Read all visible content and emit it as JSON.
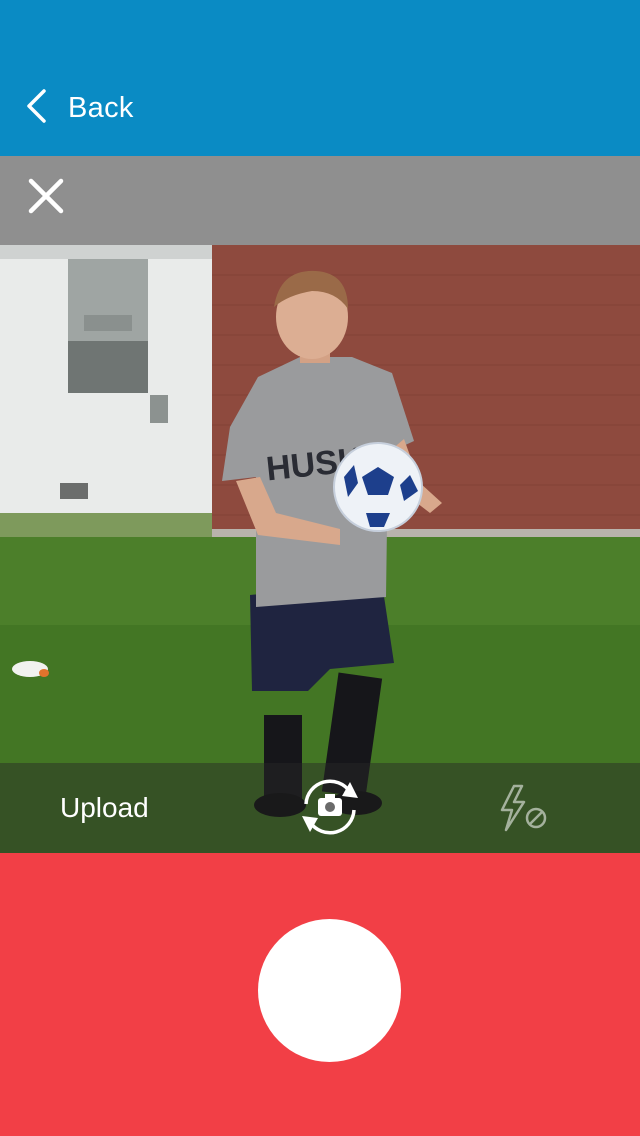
{
  "nav": {
    "back_label": "Back",
    "back_icon": "chevron-left-icon",
    "background": "#0a8bc4"
  },
  "close_bar": {
    "close_icon": "close-icon",
    "background": "#8f8f8f"
  },
  "camera": {
    "preview_image": "camera-preview",
    "shirt_text": "HUSKIE"
  },
  "controls": {
    "upload_label": "Upload",
    "switch_camera_icon": "switch-camera-icon",
    "flash_icon": "flash-off-icon"
  },
  "shutter": {
    "icon": "shutter-button",
    "background": "#f23f46"
  }
}
